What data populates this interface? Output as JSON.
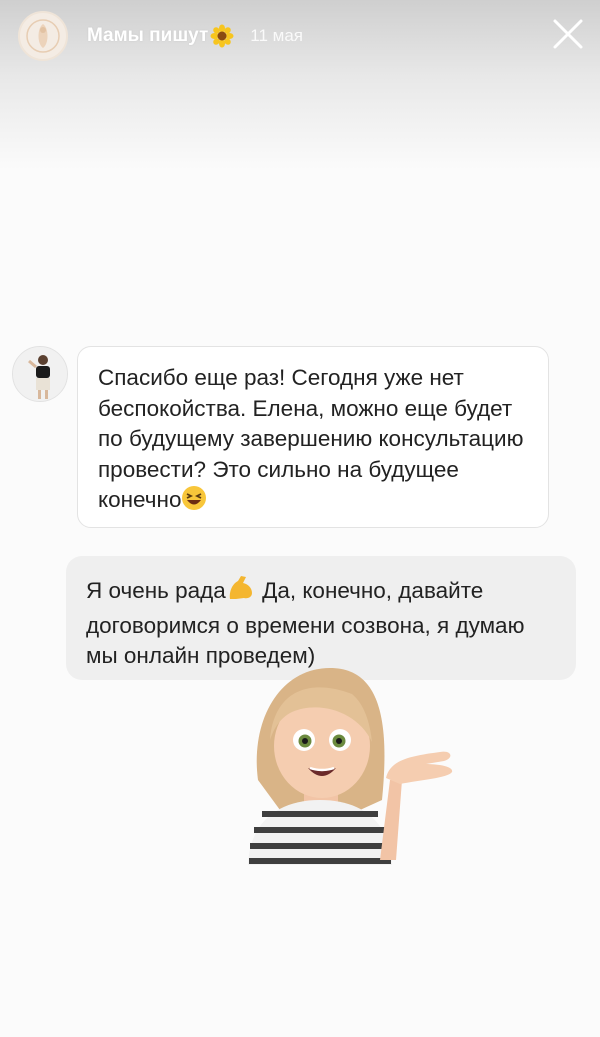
{
  "header": {
    "channel_name": "Мамы пишут",
    "date": "11 мая"
  },
  "incoming_message": {
    "text": "Спасибо еще раз! Сегодня уже нет беспокойства. Елена, можно еще будет по будущему завершению консультацию провести? Это сильно на будущее конечно",
    "emoji": "laughing-face-icon"
  },
  "outgoing_message": {
    "text_before_emoji": "Я очень рада",
    "emoji": "flexed-biceps-icon",
    "text_after_emoji": " Да, конечно, давайте договоримся о времени созвона, я думаю мы онлайн проведем)"
  },
  "sticker": "memoji-presenting-icon",
  "colors": {
    "incoming_bubble": "#ffffff",
    "outgoing_bubble": "#efefef",
    "text": "#222222",
    "header_text": "#ffffff"
  }
}
